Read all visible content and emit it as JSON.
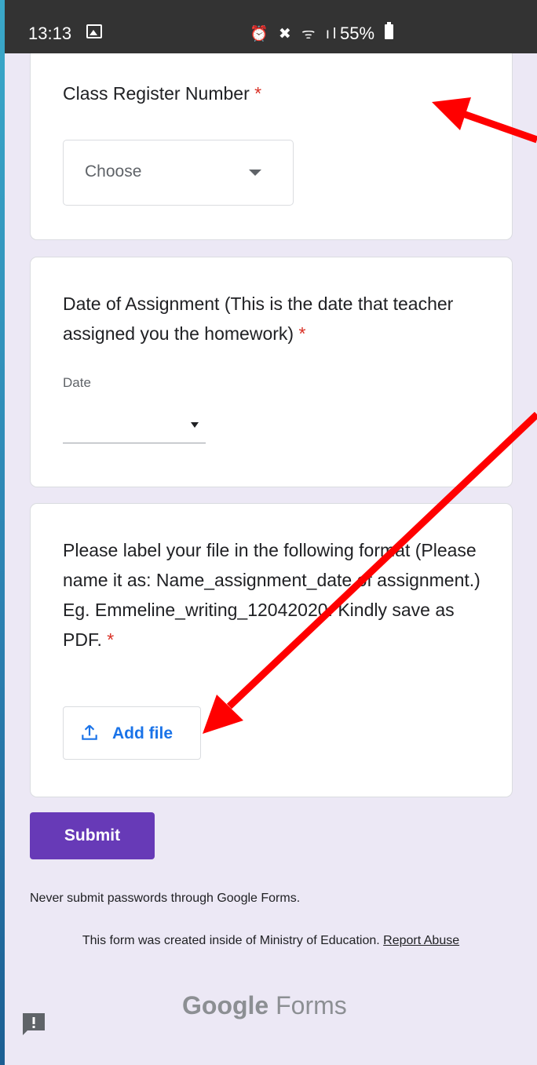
{
  "status_bar": {
    "time": "13:13",
    "icons": "⏰ ✖ ᯤ ıl",
    "battery": "55%"
  },
  "questions": [
    {
      "title": "Class Register Number",
      "required_mark": "*",
      "dropdown_value": "Choose"
    },
    {
      "title": "Date of Assignment (This is the date that teacher assigned you the homework)",
      "required_mark": "*",
      "field_label": "Date"
    },
    {
      "title": "Please label your file in the following format (Please name it as: Name_assignment_date of assignment.) Eg. Emmeline_writing_12042020. Kindly save as PDF.",
      "required_mark": "*",
      "button_label": "Add file"
    }
  ],
  "submit_label": "Submit",
  "footer": {
    "warning": "Never submit passwords through Google Forms.",
    "created_text": "This form was created inside of Ministry of Education.",
    "report_link": "Report Abuse",
    "logo_google": "Google",
    "logo_forms": "Forms"
  },
  "colors": {
    "accent": "#673ab7",
    "required": "#d93025",
    "link": "#1a73e8",
    "background": "#ece8f5",
    "annotation_arrow": "#ff0000"
  },
  "icons": [
    "gallery-icon",
    "dropdown-arrow-icon",
    "upload-icon",
    "feedback-icon",
    "battery-icon"
  ]
}
